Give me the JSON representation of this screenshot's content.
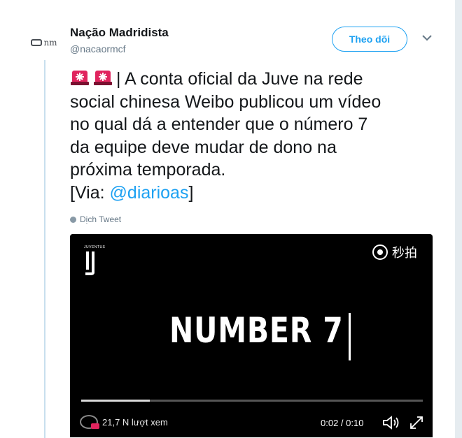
{
  "account": {
    "name": "Nação Madridista",
    "handle": "@nacaormcf",
    "avatar_text": "nm"
  },
  "follow_button": "Theo dõi",
  "menu_icon": "chevron-down-icon",
  "tweet": {
    "lines": [
      "| A conta oficial da Juve na rede",
      "social chinesa Weibo publicou um vídeo",
      "no qual dá a entender que o número 7",
      "da equipe deve mudar de dono na",
      "próxima temporada."
    ],
    "via_prefix": "[Via: ",
    "mention": "@diarioas",
    "via_suffix": "]",
    "emoji": [
      "siren-icon",
      "siren-icon"
    ]
  },
  "translate_label": "Dịch Tweet",
  "video": {
    "brand_small": "JUVENTUS",
    "watermark": "秒拍",
    "headline": "NUMBER 7",
    "progress": 0.2,
    "views": "21,7 N lượt xem",
    "time": "0:02 / 0:10"
  },
  "colors": {
    "accent": "#1da1f2",
    "thread_line": "#c8dfee",
    "siren": "#e0245e"
  }
}
